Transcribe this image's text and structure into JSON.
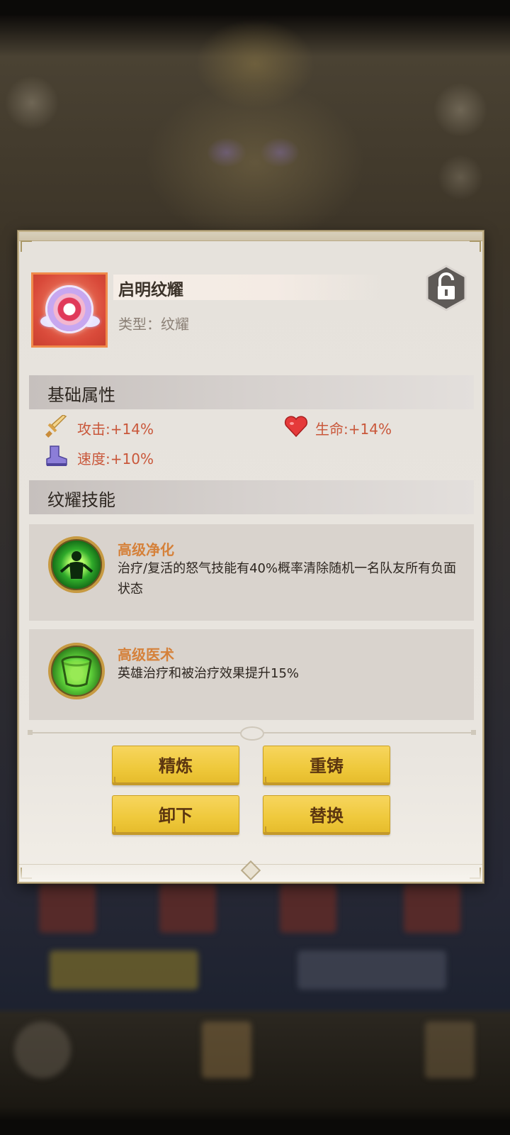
{
  "item": {
    "name": "启明纹耀",
    "type": "类型：纹耀"
  },
  "sections": {
    "base_attributes": "基础属性",
    "skills": "纹耀技能"
  },
  "attributes": [
    {
      "icon": "sword-icon",
      "label": "攻击:+14%"
    },
    {
      "icon": "heart-icon",
      "label": "生命:+14%"
    },
    {
      "icon": "boot-icon",
      "label": "速度:+10%"
    }
  ],
  "skills": [
    {
      "icon": "purify-skill-icon",
      "name": "高级净化",
      "desc": "治疗/复活的怒气技能有40%概率清除随机一名队友所有负面状态"
    },
    {
      "icon": "medicine-skill-icon",
      "name": "高级医术",
      "desc": "英雄治疗和被治疗效果提升15%"
    }
  ],
  "buttons": {
    "refine": "精炼",
    "recast": "重铸",
    "unequip": "卸下",
    "replace": "替换"
  },
  "colors": {
    "accent_orange": "#d5813a",
    "attr_red": "#c9573a",
    "button_yellow": "#efc93c"
  }
}
